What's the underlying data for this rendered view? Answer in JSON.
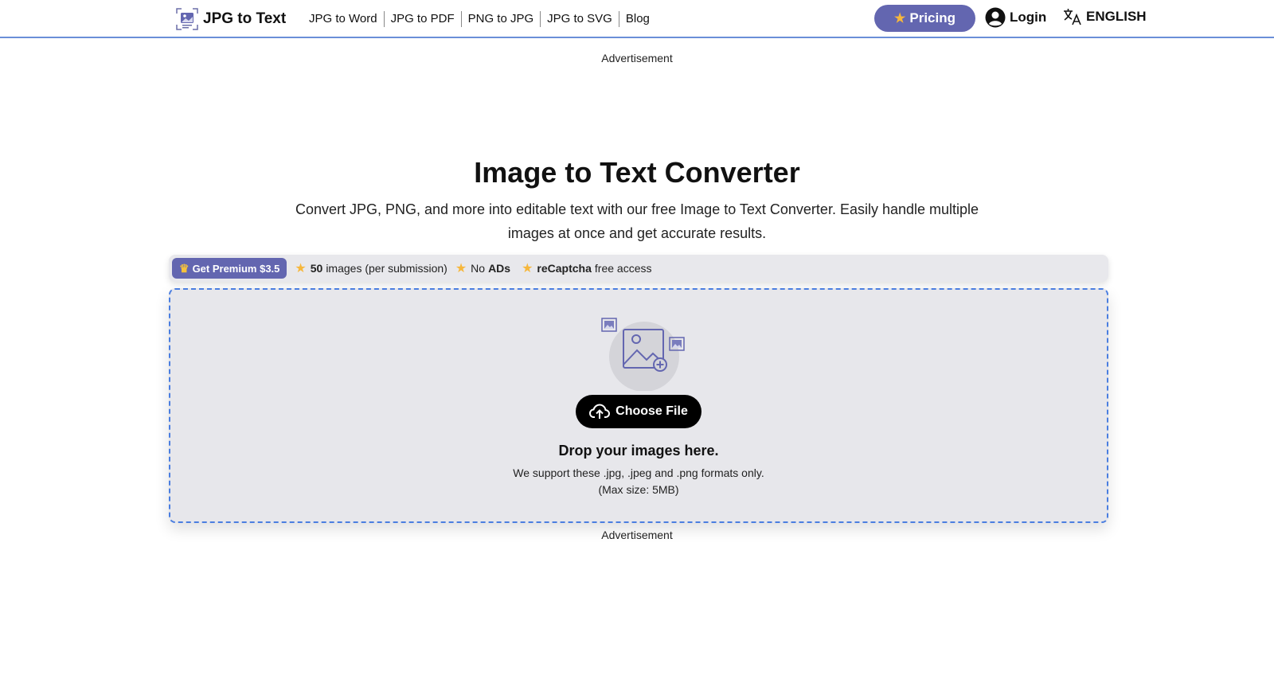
{
  "header": {
    "brand": "JPG to Text",
    "nav": [
      "JPG to Word",
      "JPG to PDF",
      "PNG to JPG",
      "JPG to SVG",
      "Blog"
    ],
    "pricing": "Pricing",
    "login": "Login",
    "language": "ENGLISH"
  },
  "ads": {
    "top": "Advertisement",
    "bottom": "Advertisement"
  },
  "main": {
    "title": "Image to Text Converter",
    "subtitle": "Convert JPG, PNG, and more into editable text with our free Image to Text Converter. Easily handle multiple images at once and get accurate results."
  },
  "features": {
    "premium_button": "Get Premium $3.5",
    "f1_bold": "50",
    "f1_text": "images (per submission)",
    "f2_pre": "No",
    "f2_bold": "ADs",
    "f3_bold": "reCaptcha",
    "f3_text": "free access"
  },
  "dropzone": {
    "button": "Choose File",
    "title": "Drop your images here.",
    "formats": "We support these .jpg, .jpeg and .png formats only.",
    "maxsize": "(Max size: 5MB)"
  },
  "colors": {
    "accent": "#6366b0",
    "star": "#f6b73c",
    "dropzone_border": "#4a7ee0"
  }
}
